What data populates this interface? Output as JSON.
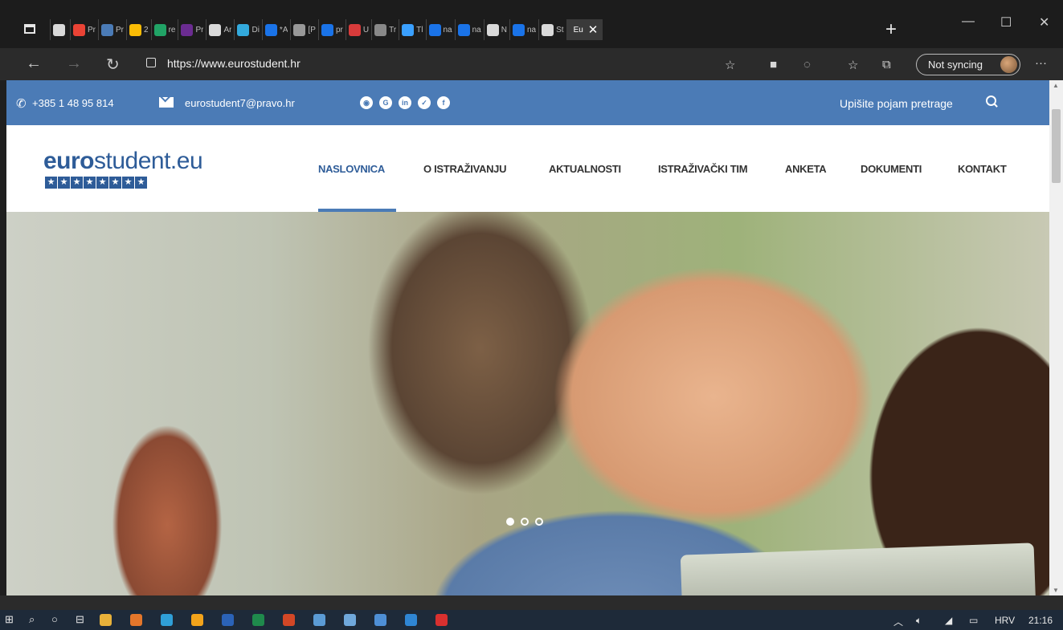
{
  "browser": {
    "tabs": [
      {
        "label": "",
        "color": "#d9d9d9"
      },
      {
        "label": "Pr",
        "color": "#ea4335"
      },
      {
        "label": "Pr",
        "color": "#4b7bb6"
      },
      {
        "label": "2",
        "color": "#fbbc05"
      },
      {
        "label": "re",
        "color": "#21a366"
      },
      {
        "label": "Pr",
        "color": "#6b2c91"
      },
      {
        "label": "Ar",
        "color": "#d9d9d9"
      },
      {
        "label": "Di",
        "color": "#33aadd"
      },
      {
        "label": "*A",
        "color": "#1a73e8"
      },
      {
        "label": "[P",
        "color": "#999999"
      },
      {
        "label": "pr",
        "color": "#1a73e8"
      },
      {
        "label": "U",
        "color": "#d83b3b"
      },
      {
        "label": "Tr",
        "color": "#888888"
      },
      {
        "label": "Tl",
        "color": "#3aa0ff"
      },
      {
        "label": "na",
        "color": "#1a73e8"
      },
      {
        "label": "na",
        "color": "#1a73e8"
      },
      {
        "label": "N",
        "color": "#d9d9d9"
      },
      {
        "label": "na",
        "color": "#1a73e8"
      },
      {
        "label": "St",
        "color": "#d9d9d9"
      }
    ],
    "active_tab": "Eu",
    "url": "https://www.eurostudent.hr",
    "sync_label": "Not syncing"
  },
  "site": {
    "phone": "+385 1 48 95 814",
    "email": "eurostudent7@pravo.hr",
    "social": [
      "rss",
      "G",
      "in",
      "tw",
      "f"
    ],
    "search_placeholder": "Upišite pojam pretrage",
    "logo_bold": "euro",
    "logo_rest": "student.eu",
    "menu": [
      "NASLOVNICA",
      "O ISTRAŽIVANJU",
      "AKTUALNOSTI",
      "ISTRAŽIVAČKI TIM",
      "ANKETA",
      "DOKUMENTI",
      "KONTAKT"
    ],
    "active_menu": "NASLOVNICA",
    "slides": 3,
    "active_slide": 1
  },
  "taskbar": {
    "language": "HRV",
    "time": "21:16"
  }
}
